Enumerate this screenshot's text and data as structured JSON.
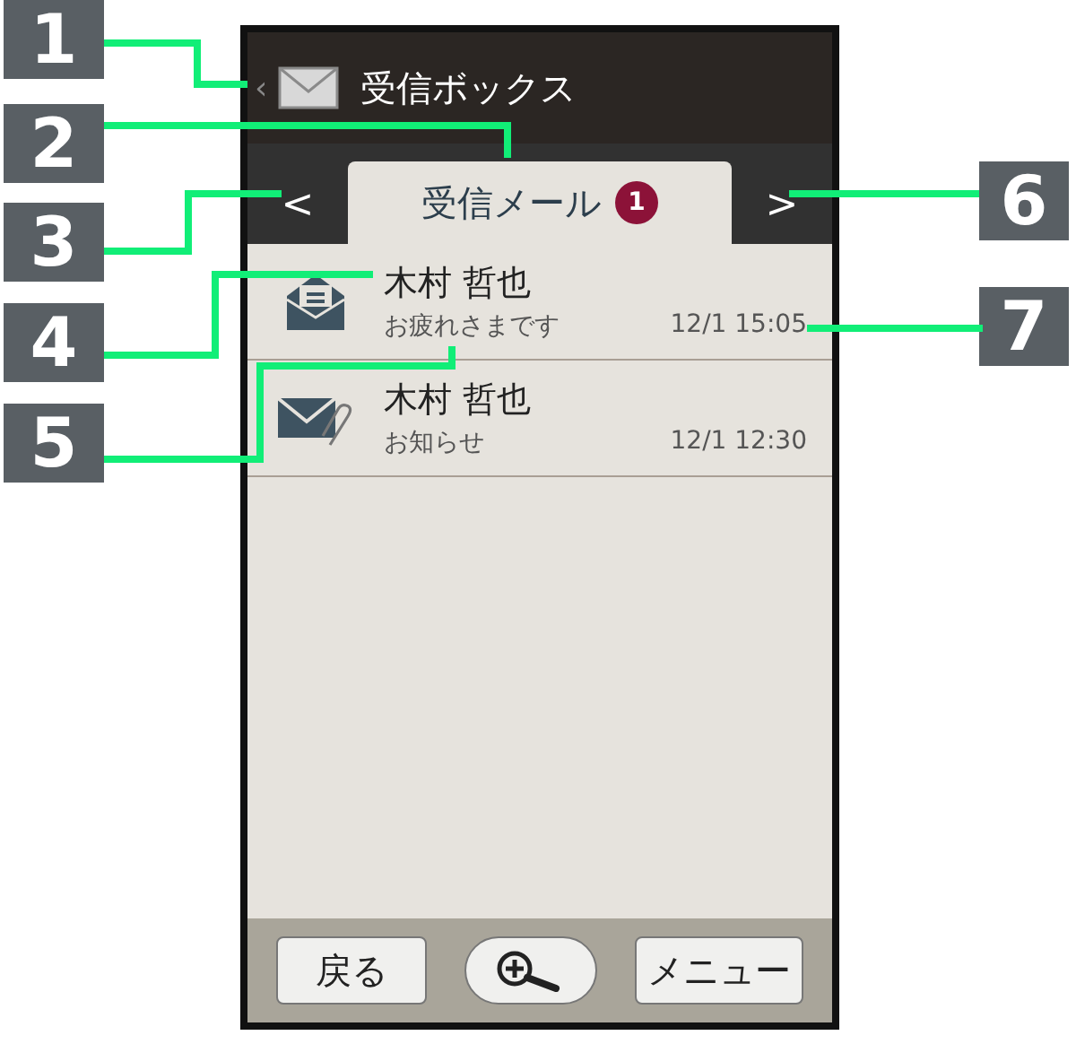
{
  "callouts": [
    {
      "number": "1",
      "kind": "left"
    },
    {
      "number": "2",
      "kind": "left"
    },
    {
      "number": "3",
      "kind": "left"
    },
    {
      "number": "4",
      "kind": "left"
    },
    {
      "number": "5",
      "kind": "left"
    },
    {
      "number": "6",
      "kind": "right"
    },
    {
      "number": "7",
      "kind": "right"
    }
  ],
  "header": {
    "back_glyph": "‹",
    "title": "受信ボックス"
  },
  "tab_bar": {
    "prev": "<",
    "next": ">",
    "tabs": [
      {
        "label": "受信メール",
        "badge": "1",
        "selected": true
      }
    ]
  },
  "messages": [
    {
      "sender": "木村 哲也",
      "subject": "お疲れさまです",
      "time": "12/1 15:05",
      "kind": "opened"
    },
    {
      "sender": "木村 哲也",
      "subject": "お知らせ",
      "time": "12/1 12:30",
      "kind": "attachment"
    }
  ],
  "buttons": [
    {
      "kind": "text",
      "label": "戻る"
    },
    {
      "kind": "zoom"
    },
    {
      "kind": "text",
      "label": "メニュー"
    }
  ]
}
